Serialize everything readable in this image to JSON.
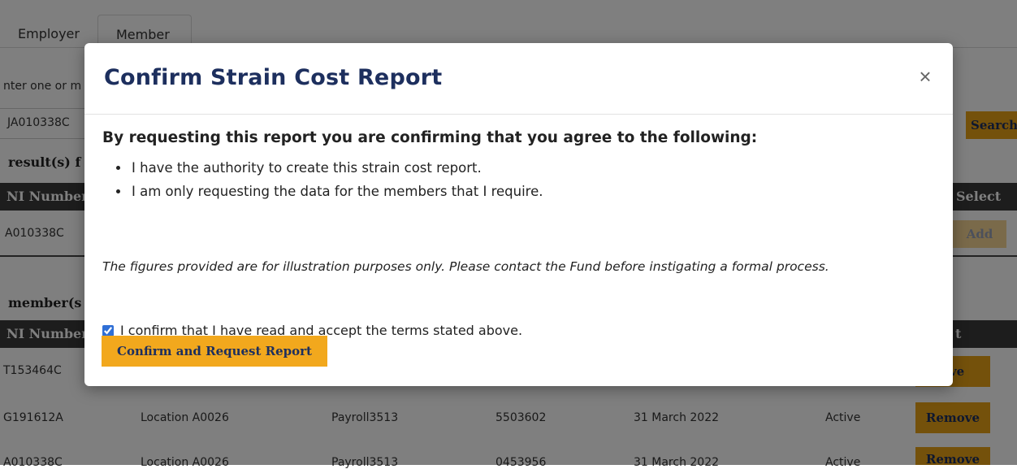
{
  "tabs": {
    "employer": "Employer",
    "member": "Member"
  },
  "search": {
    "prompt_fragment": "nter one or m",
    "input_value": "JA010338C",
    "search_button": "Search"
  },
  "results": {
    "heading_fragment": "result(s) f",
    "col_ni": "NI Number",
    "col_select": "Select",
    "row_ni": "A010338C",
    "add_button": "Add"
  },
  "members": {
    "heading_fragment": "member(s",
    "col_ni": "NI Number",
    "col_last": "t",
    "rows": [
      {
        "ni": "T153464C",
        "action": "ove"
      },
      {
        "ni": "G191612A",
        "location": "Location A0026",
        "payroll": "Payroll3513",
        "number": "5503602",
        "date": "31 March 2022",
        "status": "Active",
        "action": "Remove"
      },
      {
        "ni": "A010338C",
        "location": "Location A0026",
        "payroll": "Payroll3513",
        "number": "0453956",
        "date": "31 March 2022",
        "status": "Active",
        "action": "Remove"
      }
    ]
  },
  "modal": {
    "title": "Confirm Strain Cost Report",
    "close": "×",
    "lead": "By requesting this report you are confirming that you agree to the following:",
    "terms": [
      "I have the authority to create this strain cost report.",
      "I am only requesting the data for the members that I require."
    ],
    "disclaimer": "The figures provided are for illustration purposes only. Please contact the Fund before instigating a formal process.",
    "confirm_checkbox_label": "I confirm that I have read and accept the terms stated above.",
    "confirm_checked": true,
    "confirm_button": "Confirm and Request Report"
  },
  "colors": {
    "title": "#1d2f5e",
    "gold": "#f2a81d",
    "table_header": "#3a3a3a"
  }
}
